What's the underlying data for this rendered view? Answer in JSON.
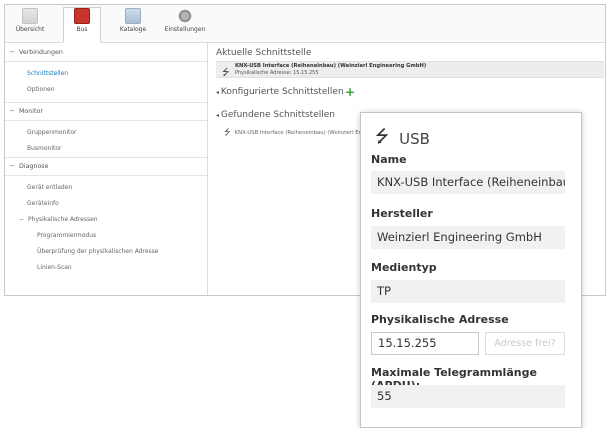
{
  "toolbar": {
    "overview": "Übersicht",
    "bus": "Bus",
    "catalogs": "Kataloge",
    "settings": "Einstellungen"
  },
  "nav": {
    "connections": "Verbindungen",
    "interfaces": "Schnittstellen",
    "options": "Optionen",
    "monitor": "Monitor",
    "group_monitor": "Gruppenmonitor",
    "bus_monitor": "Busmonitor",
    "diagnostics": "Diagnose",
    "read_device": "Gerät entladen",
    "device_info": "Geräteinfo",
    "physical_addresses": "Physikalische Adressen",
    "programming_mode": "Programmiermodus",
    "check_physical_address": "Überprüfung der physikalischen Adresse",
    "line_scan": "Linien-Scan"
  },
  "content": {
    "current_title": "Aktuelle Schnittstelle",
    "current_name": "KNX-USB Interface (Reiheneinbau) (Weinzierl Engineering GmbH)",
    "current_address": "Physikalische Adresse: 15.15.255",
    "configured_title": "Konfigurierte Schnittstellen",
    "found_title": "Gefundene Schnittstellen",
    "found_item": "KNX-USB Interface (Reiheneinbau) (Weinzierl Engi"
  },
  "popup": {
    "title": "USB",
    "name_label": "Name",
    "name_value": "KNX-USB Interface (Reiheneinbau)",
    "manufacturer_label": "Hersteller",
    "manufacturer_value": "Weinzierl Engineering GmbH",
    "medium_label": "Medientyp",
    "medium_value": "TP",
    "phys_addr_label": "Physikalische Adresse",
    "phys_addr_value": "15.15.255",
    "addr_free_button": "Adresse frei?",
    "max_len_label": "Maximale Telegrammlänge (APDU):",
    "max_len_value": "55"
  },
  "icons": {
    "usb": "usb-icon",
    "add": "plus-icon",
    "collapse": "chevron-collapse-icon"
  },
  "colors": {
    "nav_selected": "#1a7bbf",
    "add_green": "#36a437",
    "bus_red": "#c9332e"
  }
}
